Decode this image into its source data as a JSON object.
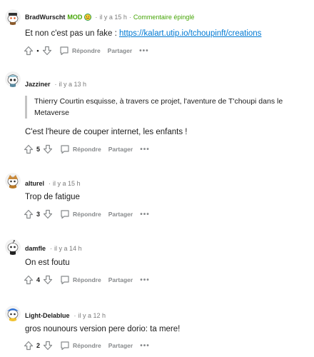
{
  "comments": [
    {
      "author": "BradWurscht",
      "mod_badge": "MOD",
      "time": "il y a 15 h",
      "pinned": "Commentaire épinglé",
      "text": "Et non c'est pas un fake : ",
      "link": "https://kalart.utip.io/tchoupinft/creations",
      "votes": "•",
      "reply_label": "Répondre",
      "share_label": "Partager",
      "more_label": "•••"
    },
    {
      "author": "Jazziner",
      "time": "il y a 13 h",
      "quote": "Thierry Courtin esquisse, à travers ce projet, l'aventure de T'choupi dans le Metaverse",
      "text": "C'est l'heure de couper internet, les enfants !",
      "votes": "5",
      "reply_label": "Répondre",
      "share_label": "Partager",
      "more_label": "•••"
    },
    {
      "author": "alturel",
      "time": "il y a 15 h",
      "text": "Trop de fatigue",
      "votes": "3",
      "reply_label": "Répondre",
      "share_label": "Partager",
      "more_label": "•••"
    },
    {
      "author": "damfle",
      "time": "il y a 14 h",
      "text": "On est foutu",
      "votes": "4",
      "reply_label": "Répondre",
      "share_label": "Partager",
      "more_label": "•••"
    },
    {
      "author": "Light-Delablue",
      "time": "il y a 12 h",
      "text": "gros nounours version pere dorio: ta mere!",
      "votes": "2",
      "reply_label": "Répondre",
      "share_label": "Partager",
      "more_label": "•••"
    }
  ],
  "icons": {
    "upvote": "upvote-arrow-icon",
    "downvote": "downvote-arrow-icon",
    "reply": "speech-bubble-icon",
    "emoji": "smile-face-emoji-icon"
  },
  "colors": {
    "link": "#0079d3",
    "mod": "#46a508",
    "meta": "#7c7c7c",
    "action": "#878a8c"
  },
  "separator": "·"
}
